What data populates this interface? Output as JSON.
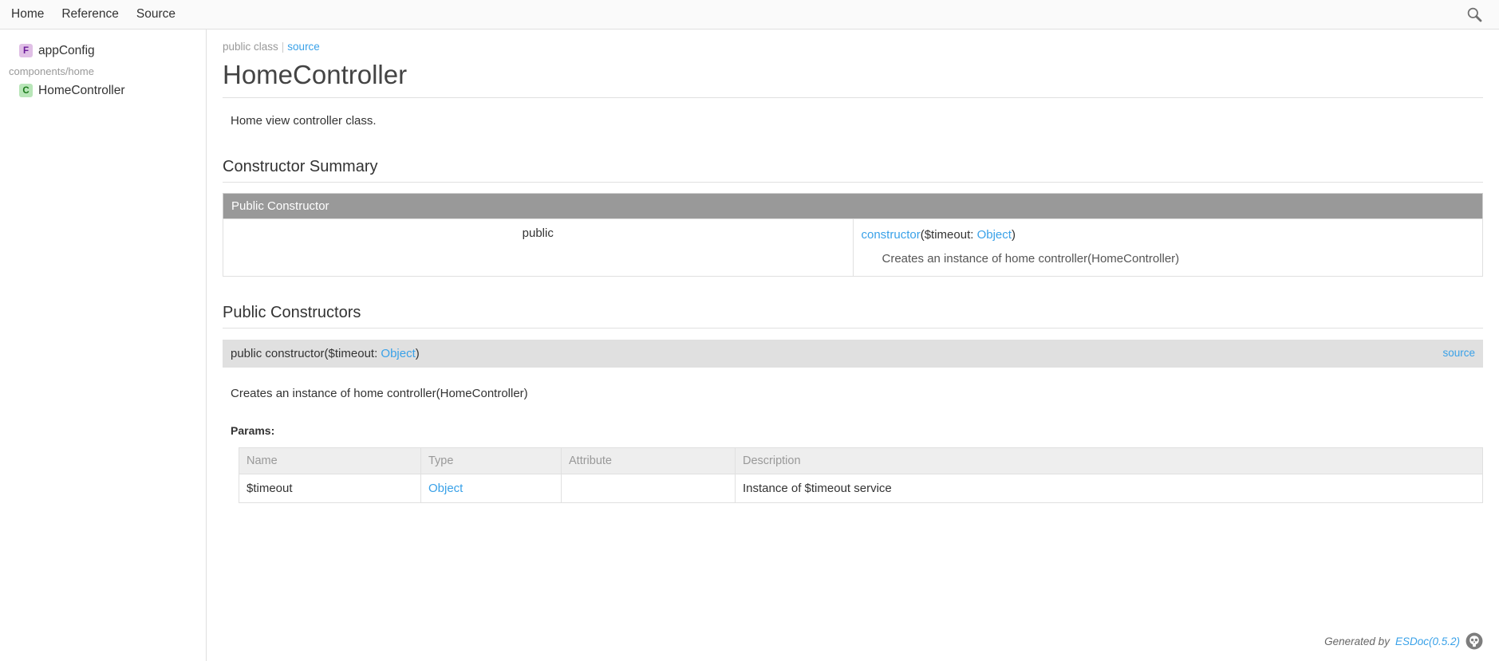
{
  "nav": {
    "links": [
      {
        "label": "Home"
      },
      {
        "label": "Reference"
      },
      {
        "label": "Source"
      }
    ],
    "search_icon": "search-icon"
  },
  "sidebar": {
    "groups": [
      {
        "dir": "",
        "items": [
          {
            "badge": "F",
            "badge_kind": "function",
            "label": "appConfig"
          }
        ]
      },
      {
        "dir": "components/home",
        "items": [
          {
            "badge": "C",
            "badge_kind": "class",
            "label": "HomeController"
          }
        ]
      }
    ]
  },
  "main": {
    "kind_notice": "public class",
    "notice_separator": "|",
    "source_label": "source",
    "title": "HomeController",
    "description": "Home view controller class.",
    "constructor_summary": {
      "heading": "Constructor Summary",
      "table_header": "Public Constructor",
      "rows": [
        {
          "access": "public",
          "name": "constructor",
          "params_open": "(",
          "param_name": "$timeout: ",
          "param_type": "Object",
          "params_close": ")",
          "description": "Creates an instance of home controller(HomeController)"
        }
      ]
    },
    "constructor_detail": {
      "heading": "Public Constructors",
      "signature_prefix": "public constructor($timeout: ",
      "signature_type": "Object",
      "signature_suffix": ")",
      "source_label": "source",
      "description": "Creates an instance of home controller(HomeController)",
      "params_label": "Params:",
      "params_table": {
        "columns": [
          "Name",
          "Type",
          "Attribute",
          "Description"
        ],
        "rows": [
          {
            "name": "$timeout",
            "type": "Object",
            "attribute": "",
            "description": "Instance of $timeout service"
          }
        ]
      }
    }
  },
  "footer": {
    "generated_by": "Generated by",
    "tool_link": "ESDoc(0.5.2)",
    "logo_icon": "esdoc-logo-icon"
  },
  "colors": {
    "link": "#39a1e8",
    "muted": "#999999",
    "summary_header_bg": "#999999",
    "detail_header_bg": "#e0e0e0",
    "params_header_bg": "#eeeeee",
    "badge_function_bg": "#e0bfe6",
    "badge_class_bg": "#b8e6b8"
  }
}
